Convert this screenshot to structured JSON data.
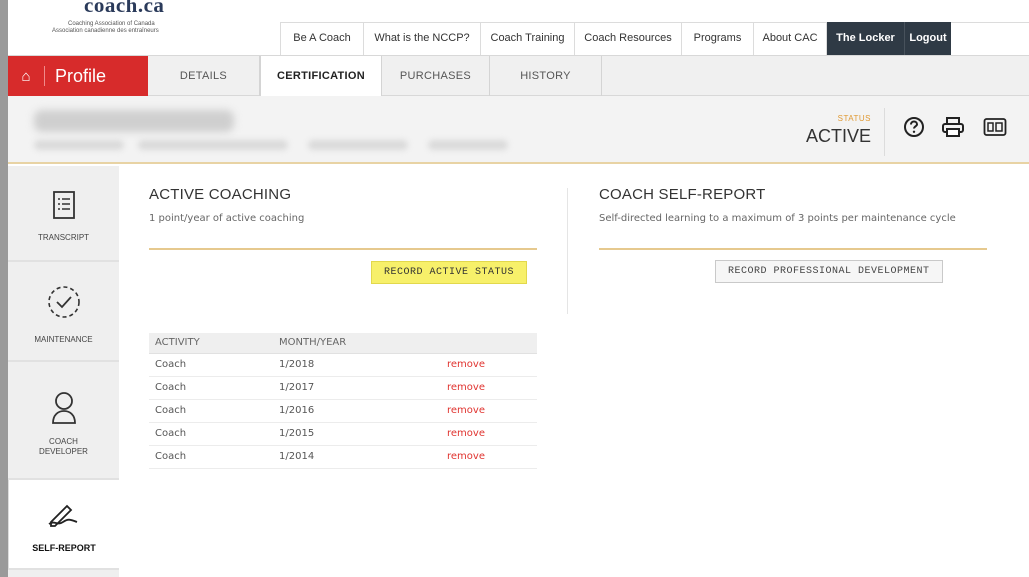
{
  "logo": {
    "brand": "coach.ca",
    "line1": "Coaching Association of Canada",
    "line2": "Association canadienne des entraîneurs"
  },
  "topnav": {
    "items": [
      "Be A Coach",
      "What is the NCCP?",
      "Coach Training",
      "Coach Resources",
      "Programs",
      "About CAC",
      "The Locker",
      "Logout"
    ]
  },
  "profile": {
    "label": "Profile",
    "icon": "home-icon"
  },
  "tabs": [
    "DETAILS",
    "CERTIFICATION",
    "PURCHASES",
    "HISTORY"
  ],
  "active_tab": "CERTIFICATION",
  "status": {
    "label": "STATUS",
    "value": "ACTIVE"
  },
  "header_icons": [
    "help-icon",
    "print-icon",
    "id-card-icon"
  ],
  "sidenav": [
    {
      "label": "TRANSCRIPT",
      "icon": "transcript-icon"
    },
    {
      "label": "MAINTENANCE",
      "icon": "maintenance-check-icon"
    },
    {
      "label_line1": "COACH",
      "label_line2": "DEVELOPER",
      "icon": "person-icon"
    },
    {
      "label": "SELF-REPORT",
      "icon": "signature-icon"
    }
  ],
  "active_coaching": {
    "title": "ACTIVE COACHING",
    "subtitle": "1 point/year of active coaching",
    "button": "RECORD ACTIVE STATUS"
  },
  "self_report": {
    "title": "COACH SELF-REPORT",
    "subtitle": "Self-directed learning to a maximum of 3 points per maintenance cycle",
    "button": "RECORD PROFESSIONAL DEVELOPMENT"
  },
  "activity_table": {
    "headers": [
      "ACTIVITY",
      "MONTH/YEAR",
      ""
    ],
    "rows": [
      {
        "activity": "Coach",
        "date": "1/2018",
        "action": "remove"
      },
      {
        "activity": "Coach",
        "date": "1/2017",
        "action": "remove"
      },
      {
        "activity": "Coach",
        "date": "1/2016",
        "action": "remove"
      },
      {
        "activity": "Coach",
        "date": "1/2015",
        "action": "remove"
      },
      {
        "activity": "Coach",
        "date": "1/2014",
        "action": "remove"
      }
    ]
  },
  "colors": {
    "profile_red": "#d72b2b",
    "locker_dark": "#2f3a45",
    "status_orange": "#e09a34",
    "gold_rule": "#e6c98e",
    "highlight_yellow": "#f7f06a",
    "remove_red": "#e0332f"
  }
}
